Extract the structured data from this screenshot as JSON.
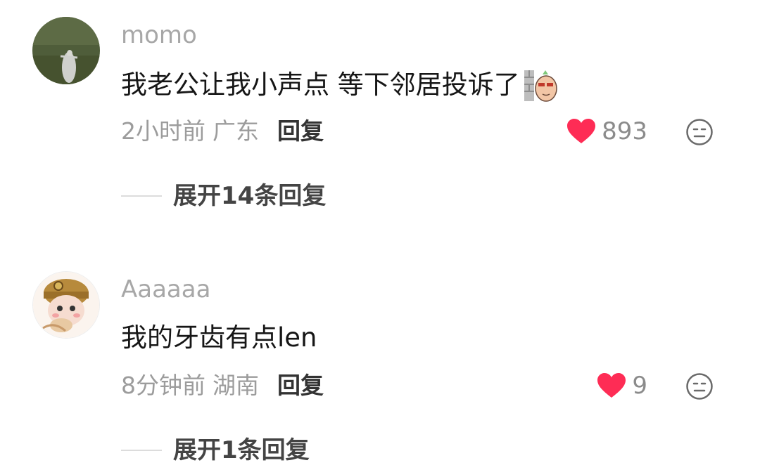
{
  "comments": [
    {
      "username": "momo",
      "content": "我老公让我小声点 等下邻居投诉了",
      "sticker": "wall-peek-sticker",
      "time": "2小时前",
      "location": "广东",
      "reply_label": "回复",
      "likes": "893",
      "expand_label": "展开14条回复"
    },
    {
      "username": "Aaaaaa",
      "content": "我的牙齿有点len",
      "time": "8分钟前",
      "location": "湖南",
      "reply_label": "回复",
      "likes": "9",
      "expand_label": "展开1条回复"
    }
  ],
  "colors": {
    "like_heart": "#fe2c55",
    "username": "#a7a7a7",
    "content": "#161616",
    "meta": "#9c9c9c"
  },
  "icons": {
    "like": "heart-icon",
    "dislike": "neutral-face-icon"
  }
}
